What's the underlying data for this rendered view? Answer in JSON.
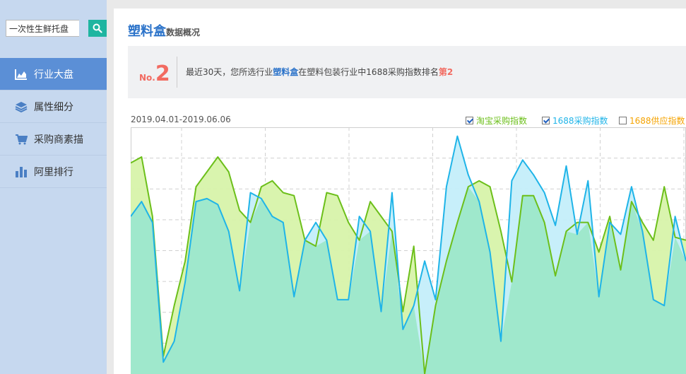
{
  "sidebar": {
    "search": {
      "value": "一次性生鲜托盘"
    },
    "items": [
      {
        "label": "行业大盘",
        "icon": "area-chart-icon",
        "active": true
      },
      {
        "label": "属性细分",
        "icon": "layers-icon",
        "active": false
      },
      {
        "label": "采购商素描",
        "icon": "cart-icon",
        "active": false
      },
      {
        "label": "阿里排行",
        "icon": "bar-chart-icon",
        "active": false
      }
    ]
  },
  "header": {
    "title_main": "塑料盒",
    "title_sub": "数据概况"
  },
  "rank": {
    "no_label": "No.",
    "no_value": "2",
    "text_prefix": "最近30天，您所选行业",
    "category": "塑料盒",
    "text_middle": "在塑料包装行业中1688采购指数排名",
    "rank_text": "第2"
  },
  "date_range": "2019.04.01-2019.06.06",
  "colors": {
    "taobao": "#6cbf1a",
    "taobao_fill": "#d7f3aa",
    "purchase": "#1fb4e8",
    "purchase_fill": "#c4eefa",
    "overlap_fill": "#9fe8cc",
    "supply": "#f5a300",
    "accent": "#2a72c9",
    "rank_red": "#f26b61"
  },
  "chart_data": {
    "type": "area",
    "title": "",
    "xlabel": "",
    "ylabel": "",
    "grid": true,
    "legend_position": "top-right",
    "series": [
      {
        "name": "淘宝采购指数",
        "checked": true,
        "values": [
          68,
          70,
          50,
          3,
          20,
          35,
          60,
          65,
          70,
          65,
          52,
          48,
          60,
          62,
          58,
          57,
          42,
          40,
          58,
          57,
          48,
          42,
          55,
          50,
          45,
          18,
          40,
          -3,
          20,
          35,
          48,
          60,
          62,
          60,
          45,
          28,
          57,
          57,
          48,
          30,
          45,
          48,
          48,
          38,
          50,
          32,
          55,
          48,
          42,
          60,
          43,
          42
        ]
      },
      {
        "name": "1688采购指数",
        "checked": true,
        "values": [
          50,
          55,
          48,
          1,
          8,
          28,
          55,
          56,
          54,
          45,
          25,
          58,
          56,
          50,
          48,
          23,
          42,
          48,
          42,
          22,
          22,
          50,
          45,
          18,
          58,
          12,
          20,
          35,
          22,
          60,
          77,
          64,
          55,
          38,
          8,
          62,
          69,
          64,
          58,
          47,
          67,
          44,
          62,
          23,
          48,
          44,
          60,
          45,
          22,
          20,
          50,
          35
        ]
      },
      {
        "name": "1688供应指数",
        "checked": false,
        "values": []
      }
    ],
    "ylim": [
      -3,
      80
    ]
  }
}
